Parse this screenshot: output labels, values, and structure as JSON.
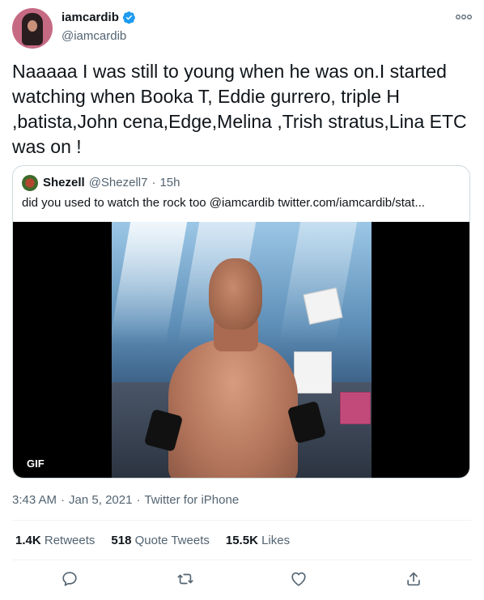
{
  "author": {
    "display_name": "iamcardib",
    "handle": "@iamcardib",
    "verified": true
  },
  "tweet": {
    "text": "Naaaaa I was still to young when he was on.I started\nwatching when Booka T, Eddie gurrero, triple H\n,batista,John cena,Edge,Melina ,Trish stratus,Lina ETC\nwas on !",
    "time": "3:43 AM",
    "date": "Jan 5, 2021",
    "source": "Twitter for iPhone",
    "separator": "·"
  },
  "quote": {
    "name": "Shezell",
    "handle": "@Shezell7",
    "separator": "·",
    "time": "15h",
    "text": "did you used to watch the rock too @iamcardib  twitter.com/iamcardib/stat...",
    "media_badge": "GIF"
  },
  "stats": {
    "retweets_count": "1.4K",
    "retweets_label": "Retweets",
    "quote_tweets_count": "518",
    "quote_tweets_label": "Quote Tweets",
    "likes_count": "15.5K",
    "likes_label": "Likes"
  },
  "icons": {
    "reply": "reply-icon",
    "retweet": "retweet-icon",
    "like": "heart-icon",
    "share": "share-icon",
    "more": "more-icon",
    "verified": "verified-badge-icon"
  },
  "colors": {
    "text": "#0f1419",
    "secondary": "#536471",
    "verified": "#1d9bf0",
    "border": "#cfd9de"
  }
}
